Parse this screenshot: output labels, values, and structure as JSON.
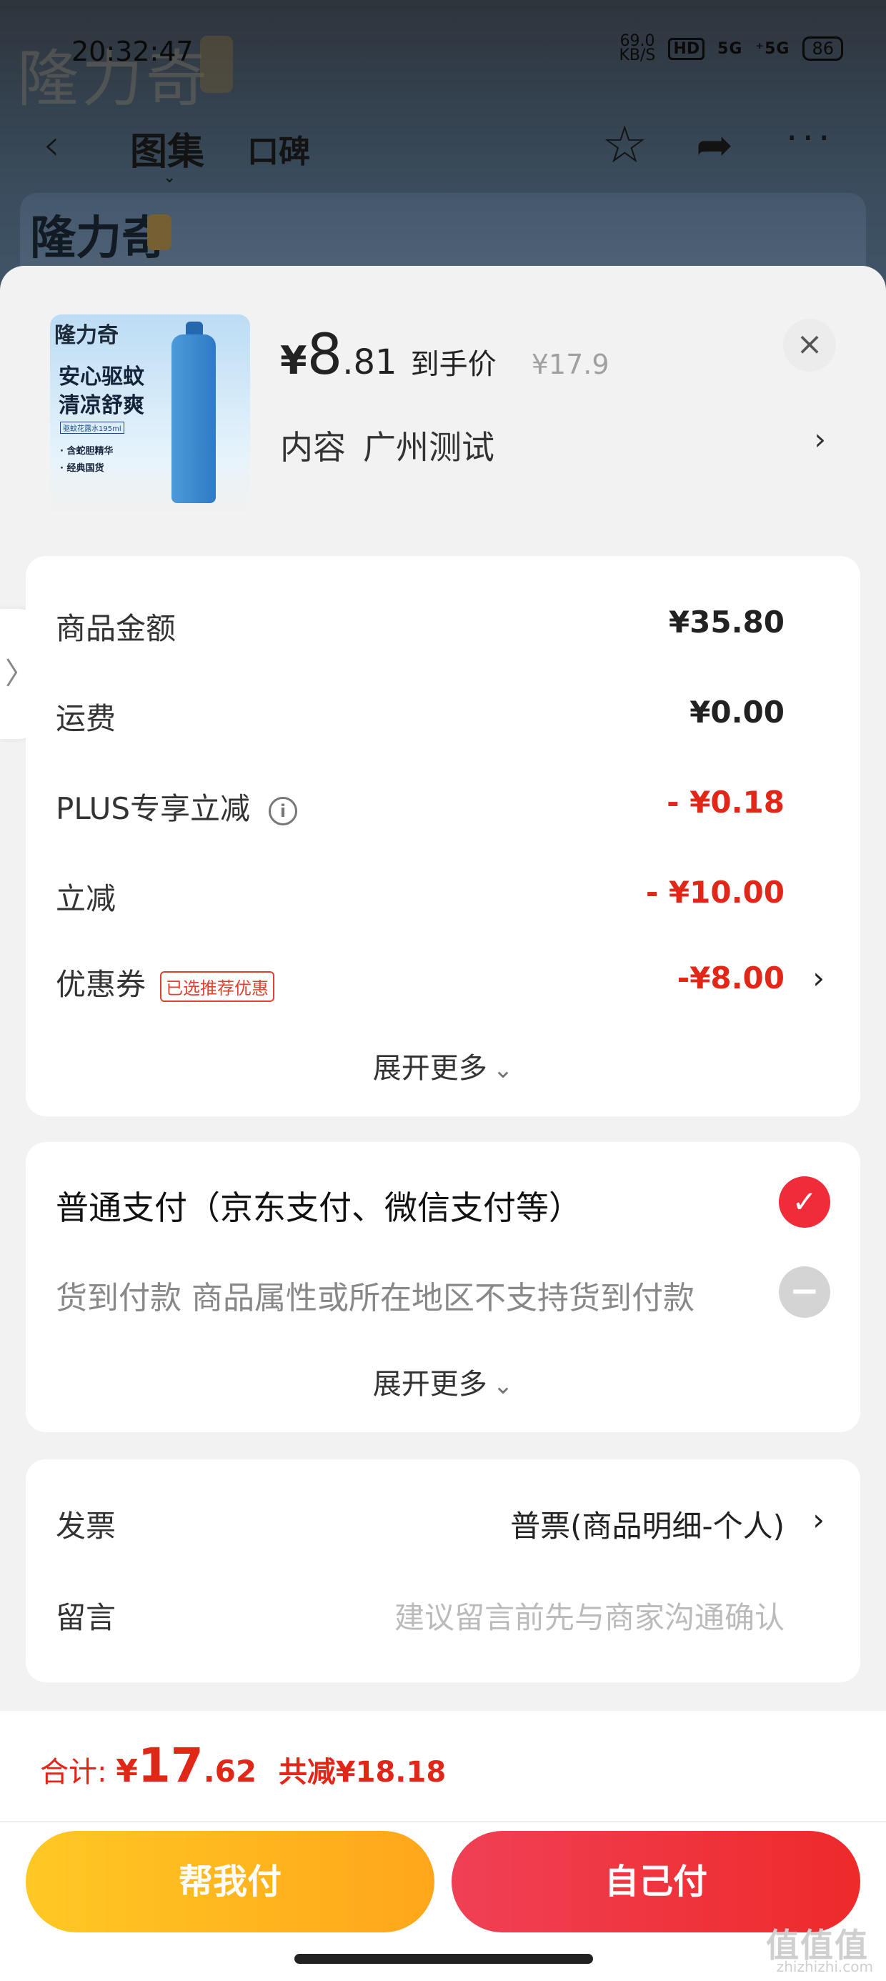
{
  "status_bar": {
    "time": "20:32:47",
    "speed_value": "69.0",
    "speed_unit": "KB/S",
    "hd": "HD",
    "signal1": "5G",
    "signal2": "⁺5G",
    "battery": "86"
  },
  "nav": {
    "back": "‹",
    "tab_gallery": "图集",
    "tab_reviews": "口碑",
    "star": "☆",
    "share": "➦",
    "more": "···"
  },
  "brand": {
    "name": "隆力奇"
  },
  "product": {
    "thumb_slogan_1": "安心驱蚊",
    "thumb_slogan_2": "清凉舒爽",
    "thumb_spec": "驱蚊花露水195ml",
    "thumb_feat_1": "· 含蛇胆精华",
    "thumb_feat_2": "· 经典国货",
    "price_currency": "¥",
    "price_int": "8",
    "price_dec": ".81",
    "price_label": "到手价",
    "orig_price": "¥17.9",
    "spec_label": "内容",
    "spec_value": "广州测试",
    "spec_chevron": "›",
    "close": "×"
  },
  "costs": [
    {
      "label": "商品金额",
      "value": "¥35.80"
    },
    {
      "label": "运费",
      "value": "¥0.00"
    },
    {
      "label": "PLUS专享立减",
      "value": "- ¥0.18",
      "info": "i"
    },
    {
      "label": "立减",
      "value": "- ¥10.00"
    },
    {
      "label": "优惠券",
      "badge": "已选推荐优惠",
      "value": "-¥8.00",
      "chevron": "›"
    }
  ],
  "expand_more": "展开更多",
  "expand_arrow": "⌄",
  "payment": {
    "normal": "普通支付（京东支付、微信支付等）",
    "cod": "货到付款 商品属性或所在地区不支持货到付款",
    "check": "✓",
    "minus": "−"
  },
  "invoice": {
    "label": "发票",
    "value": "普票(商品明细-个人)",
    "chevron": "›"
  },
  "message": {
    "label": "留言",
    "placeholder": "建议留言前先与商家沟通确认"
  },
  "footer": {
    "total_label": "合计:",
    "total_currency": "¥",
    "total_int": "17",
    "total_dec": ".62",
    "saved": "共减¥18.18",
    "help_pay": "帮我付",
    "self_pay": "自己付"
  },
  "side_tab": "〉",
  "watermark": {
    "main": "值值值",
    "sub": "zhizhizhi.com"
  },
  "colors": {
    "accent": "#e02718",
    "check": "#f02b3a",
    "help_btn": "#ffb81f",
    "self_btn": "#ee2a3a"
  }
}
